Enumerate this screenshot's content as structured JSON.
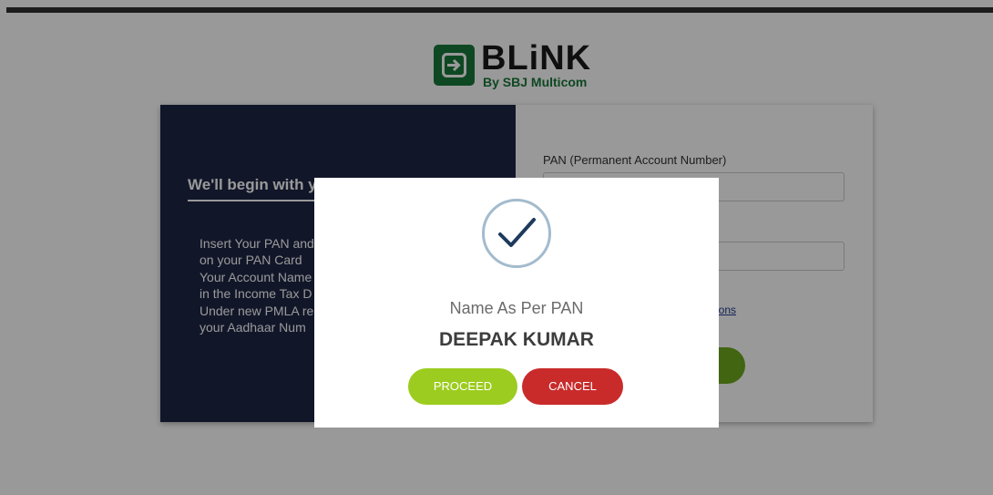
{
  "brand": {
    "name": "BLiNK",
    "tagline": "By SBJ Multicom",
    "color": "#18783a"
  },
  "intro": {
    "heading": "We'll begin with y",
    "lines": [
      "Insert Your PAN and",
      "on your PAN Card",
      "Your Account Name",
      "in the Income Tax D",
      "Under new PMLA re",
      "your Aadhaar Num"
    ]
  },
  "form": {
    "pan_label": "PAN (Permanent Account Number)",
    "pan_value": "",
    "date_value": "",
    "link_fragment": "ions"
  },
  "modal": {
    "label": "Name As Per PAN",
    "name": "DEEPAK KUMAR",
    "proceed_label": "PROCEED",
    "cancel_label": "CANCEL",
    "proceed_color": "#9ccc1f",
    "cancel_color": "#c92b2b"
  }
}
